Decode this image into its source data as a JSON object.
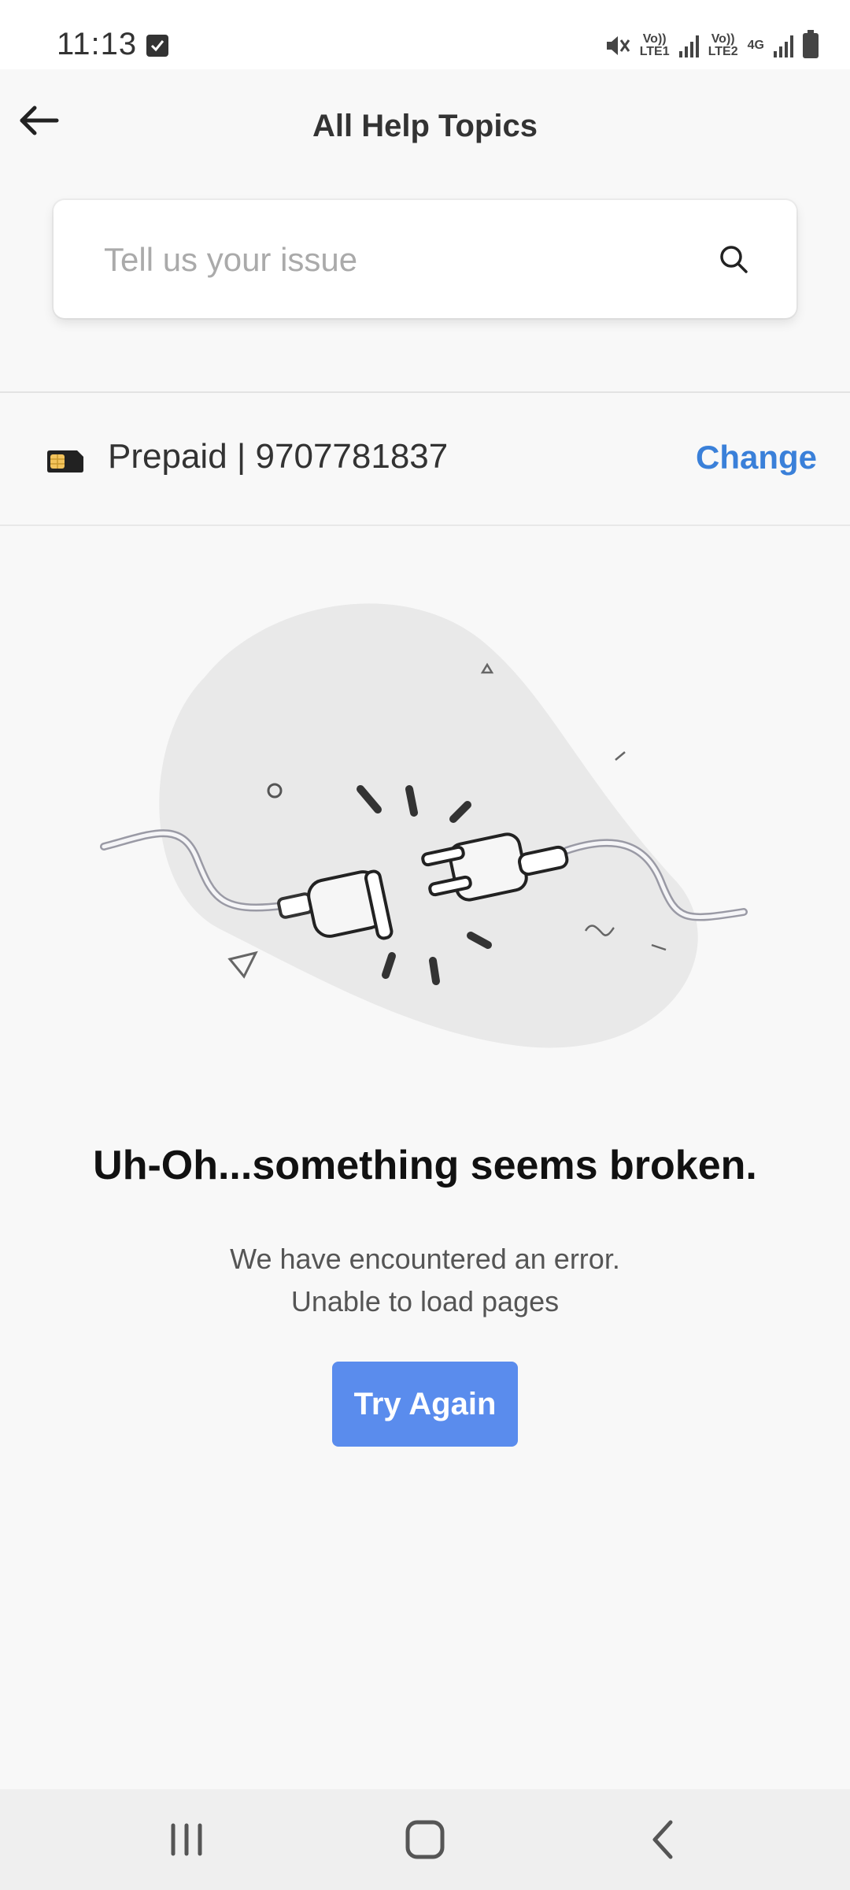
{
  "status_bar": {
    "time": "11:13",
    "sim1_label": "Vo)) LTE1",
    "sim2_label": "Vo)) LTE2",
    "network": "4G"
  },
  "header": {
    "title": "All Help Topics",
    "back_icon": "arrow-left-icon"
  },
  "search": {
    "placeholder": "Tell us your issue",
    "value": "",
    "icon": "search-icon"
  },
  "account": {
    "icon": "sim-card-icon",
    "text": "Prepaid | 9707781837",
    "change_label": "Change"
  },
  "error": {
    "illustration": "unplugged-cable-icon",
    "title": "Uh-Oh...something seems broken.",
    "line1": "We have encountered an error.",
    "line2": "Unable to load pages",
    "retry_label": "Try Again"
  },
  "nav": {
    "recents_icon": "recents-icon",
    "home_icon": "home-icon",
    "back_icon": "back-chevron-icon"
  },
  "colors": {
    "accent": "#3a80d9",
    "button": "#5a8ced",
    "background": "#f8f8f8"
  }
}
